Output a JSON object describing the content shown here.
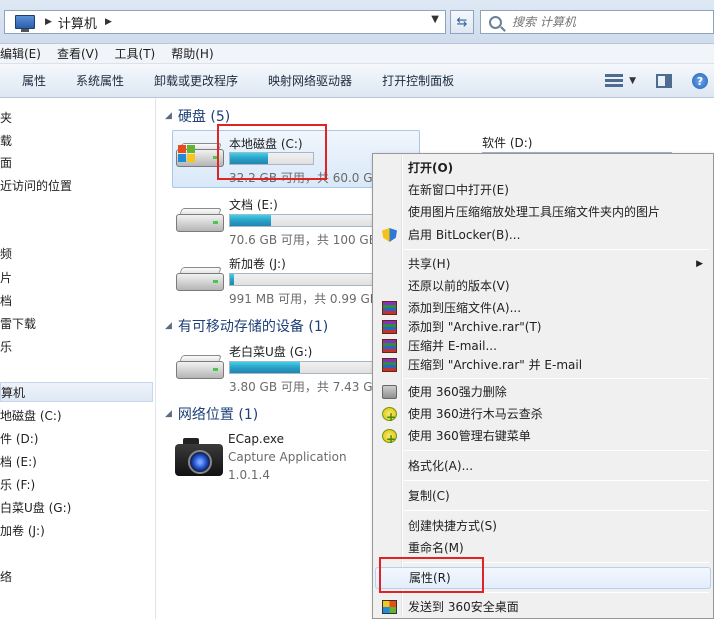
{
  "address": {
    "crumb": "计算机",
    "search_placeholder": "搜索 计算机"
  },
  "menubar": [
    "编辑(E)",
    "查看(V)",
    "工具(T)",
    "帮助(H)"
  ],
  "toolbar": [
    "属性",
    "系统属性",
    "卸载或更改程序",
    "映射网络驱动器",
    "打开控制面板"
  ],
  "navpane": [
    "夹",
    "载",
    "面",
    "近访问的位置",
    "频",
    "片",
    "档",
    "雷下载",
    "乐",
    "算机",
    "地磁盘 (C:)",
    "件 (D:)",
    "档 (E:)",
    "乐 (F:)",
    "白菜U盘 (G:)",
    "加卷 (J:)",
    "络"
  ],
  "groups": {
    "hdd": "硬盘 (5)",
    "removable": "有可移动存储的设备 (1)",
    "network": "网络位置 (1)"
  },
  "drives": {
    "c": {
      "name": "本地磁盘 (C:)",
      "info": "32.2 GB 可用，共 60.0 GB",
      "used": 0.46
    },
    "d": {
      "name": "软件 (D:)",
      "used": 0.6
    },
    "e": {
      "name": "文档 (E:)",
      "info": "70.6 GB 可用，共 100 GB",
      "used": 0.29
    },
    "j": {
      "name": "新加卷 (J:)",
      "info": "991 MB 可用，共 0.99 GB",
      "used": 0.03
    },
    "g": {
      "name": "老白菜U盘 (G:)",
      "info": "3.80 GB 可用，共 7.43 GB",
      "used": 0.49
    }
  },
  "network_item": {
    "name": "ECap.exe",
    "desc": "Capture Application",
    "version": "1.0.1.4"
  },
  "context_menu": {
    "open": "打开(O)",
    "open_new": "在新窗口中打开(E)",
    "compress_img": "使用图片压缩缩放处理工具压缩文件夹内的图片",
    "bitlocker": "启用 BitLocker(B)...",
    "share": "共享(H)",
    "restore": "还原以前的版本(V)",
    "add_archive": "添加到压缩文件(A)...",
    "add_rar": "添加到 \"Archive.rar\"(T)",
    "compress_email": "压缩并 E-mail...",
    "compress_rar_email": "压缩到 \"Archive.rar\" 并 E-mail",
    "del_360": "使用 360强力删除",
    "scan_360": "使用 360进行木马云查杀",
    "menu_360": "使用 360管理右键菜单",
    "format": "格式化(A)...",
    "copy": "复制(C)",
    "shortcut": "创建快捷方式(S)",
    "rename": "重命名(M)",
    "properties": "属性(R)",
    "send_360": "发送到 360安全桌面"
  }
}
